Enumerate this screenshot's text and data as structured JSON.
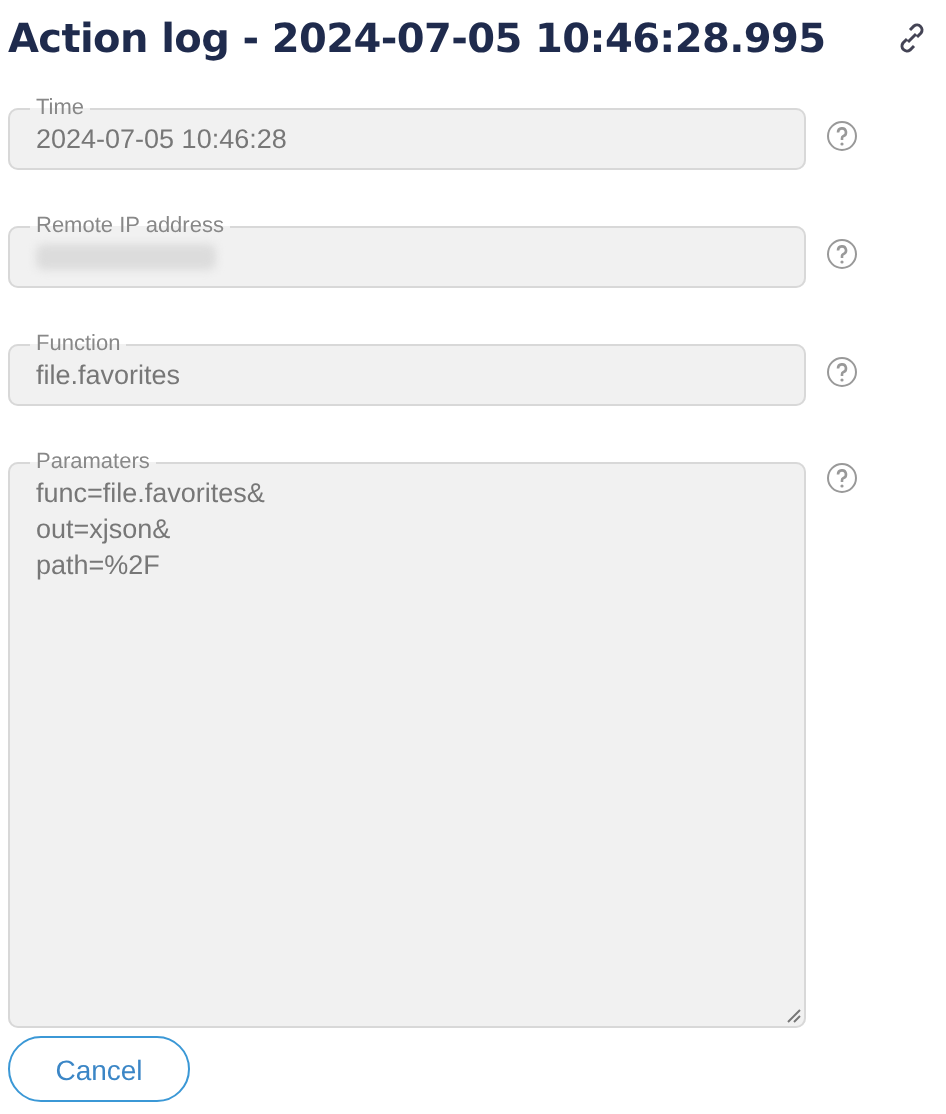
{
  "title": "Action log - 2024-07-05 10:46:28.995",
  "fields": [
    {
      "kind": "input",
      "label": "Time",
      "value": "2024-07-05 10:46:28",
      "redacted": false
    },
    {
      "kind": "input",
      "label": "Remote IP address",
      "redacted": true
    },
    {
      "kind": "input",
      "label": "Function",
      "value": "file.favorites",
      "redacted": false
    },
    {
      "kind": "textarea",
      "label": "Paramaters",
      "value": "func=file.favorites&\nout=xjson&\npath=%2F",
      "redacted": false
    }
  ],
  "buttons": [
    {
      "label": "Cancel"
    }
  ]
}
